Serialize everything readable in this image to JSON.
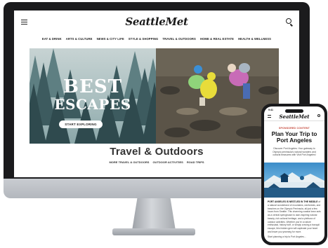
{
  "site": {
    "logo": "SeattleMet",
    "nav": [
      "EAT & DRINK",
      "ARTS & CULTURE",
      "NEWS & CITY LIFE",
      "STYLE & SHOPPING",
      "TRAVEL & OUTDOORS",
      "HOME & REAL ESTATE",
      "HEALTH & WELLNESS"
    ]
  },
  "hero": {
    "headline_line1": "BEST",
    "headline_line2": "ESCAPES",
    "cta": "START EXPLORING"
  },
  "section": {
    "title": "Travel & Outdoors",
    "subnav": [
      "MORE TRAVEL & OUTDOORS",
      "OUTDOOR ACTIVITIES",
      "ROAD TRIPS"
    ]
  },
  "phone": {
    "time": "9:41",
    "logo": "SeattleMet",
    "label": "SPONSORED CONTENT",
    "title": "Plan Your Trip to Port Angeles",
    "intro": "Discover Port Angeles: Your gateway to Olympic peninsula's natural wonders and cultural treasures with Visit Port Angeles!",
    "body_lead": "PORT ANGELES IS NESTLED IN THE MIDDLE",
    "body": "of a natural wonderland of mountains, rainforests, and beaches on the Olympic Peninsula, all just a few hours from Seattle. This charming coastal town acts as a central springboard to awe-inspiring natural beauty, rich cultural heritage, and a plethora of outdoor activities. Whether you're a nature enthusiast, history buff, or simply craving a tranquil escape, this hidden gem will captivate your heart and leave you yearning for more.",
    "footer": "Start planning a trip to Port Angeles..."
  },
  "colors": {
    "sponsored": "#c0392b",
    "forest": "#2f4a4e",
    "bezel": "#1b1b1d"
  }
}
